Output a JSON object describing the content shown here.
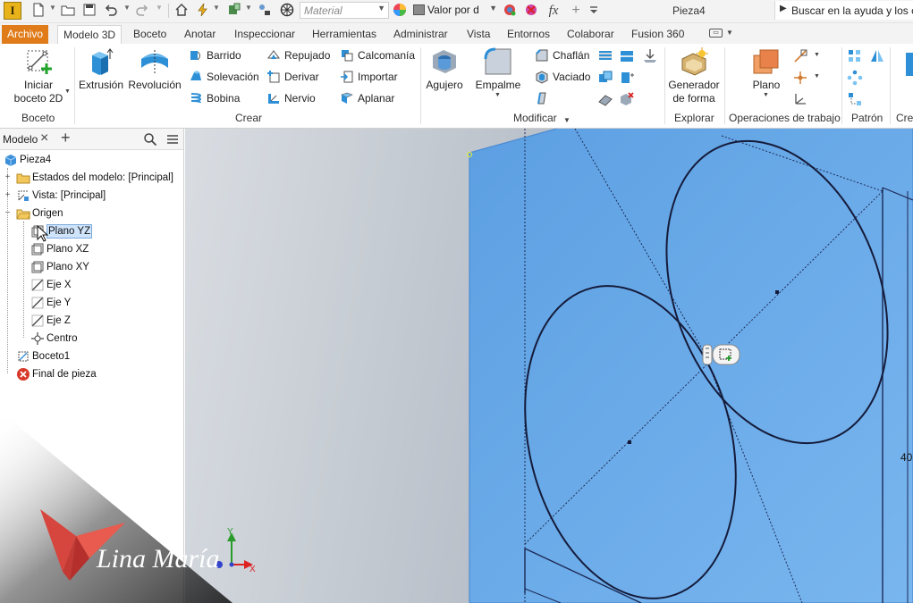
{
  "titlebar": {
    "app_logo_letter": "I",
    "material_placeholder": "Material",
    "appearance_value": "Valor por d",
    "function_symbol": "fx",
    "document_title": "Pieza4",
    "help_search": "Buscar en la ayuda y los c"
  },
  "tabs": [
    {
      "label": "Archivo"
    },
    {
      "label": "Modelo 3D"
    },
    {
      "label": "Boceto"
    },
    {
      "label": "Anotar"
    },
    {
      "label": "Inspeccionar"
    },
    {
      "label": "Herramientas"
    },
    {
      "label": "Administrar"
    },
    {
      "label": "Vista"
    },
    {
      "label": "Entornos"
    },
    {
      "label": "Colaborar"
    },
    {
      "label": "Fusion 360"
    }
  ],
  "ribbon": {
    "boceto": {
      "title": "Boceto",
      "start_sketch_line1": "Iniciar",
      "start_sketch_line2": "boceto 2D"
    },
    "crear": {
      "title": "Crear",
      "extrude": "Extrusión",
      "revolve": "Revolución",
      "sweep": "Barrido",
      "loft": "Solevación",
      "coil": "Bobina",
      "emboss": "Repujado",
      "derive": "Derivar",
      "rib": "Nervio",
      "decal": "Calcomanía",
      "import": "Importar",
      "unwrap": "Aplanar"
    },
    "modificar": {
      "title": "Modificar",
      "hole": "Agujero",
      "fillet": "Empalme",
      "chamfer": "Chaflán",
      "shell": "Vaciado"
    },
    "explorar": {
      "title": "Explorar",
      "shape_gen_line1": "Generador",
      "shape_gen_line2": "de forma"
    },
    "work_features": {
      "title": "Operaciones de trabajo",
      "plane": "Plano"
    },
    "patron": {
      "title": "Patrón"
    },
    "crear_cut": {
      "title": "Cre"
    }
  },
  "browser": {
    "tab_label": "Modelo",
    "nodes": [
      {
        "label": "Pieza4"
      },
      {
        "label": "Estados del modelo: [Principal]"
      },
      {
        "label": "Vista: [Principal]"
      },
      {
        "label": "Origen"
      },
      {
        "label": "Plano YZ"
      },
      {
        "label": "Plano XZ"
      },
      {
        "label": "Plano XY"
      },
      {
        "label": "Eje X"
      },
      {
        "label": "Eje Y"
      },
      {
        "label": "Eje Z"
      },
      {
        "label": "Centro"
      },
      {
        "label": "Boceto1"
      },
      {
        "label": "Final de pieza"
      }
    ]
  },
  "watermark": {
    "text": "Lina María"
  },
  "viewport": {
    "dimension_text": "40",
    "axis_y": "Y",
    "axis_x": "X"
  },
  "colors": {
    "file_tab": "#e07b1a",
    "plane_fill": "#6aa6e3",
    "selection": "#cfe4fb"
  }
}
